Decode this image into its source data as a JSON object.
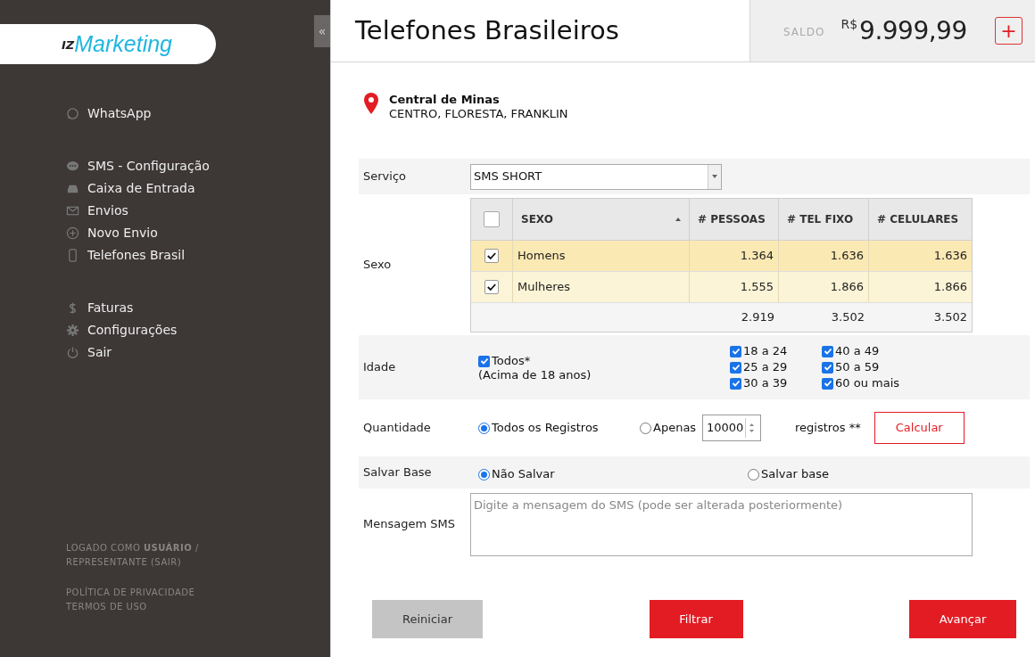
{
  "sidebar": {
    "logo": {
      "prefix": "IZ",
      "name": "Marketing"
    },
    "collapse_button": "«",
    "nav_groups": [
      [
        {
          "label": "WhatsApp",
          "kind": "whatsapp"
        }
      ],
      [
        {
          "label": "SMS - Configuração",
          "kind": "chat"
        },
        {
          "label": "Caixa de Entrada",
          "kind": "inbox"
        },
        {
          "label": "Envios",
          "kind": "mail"
        },
        {
          "label": "Novo Envio",
          "kind": "plus"
        },
        {
          "label": "Telefones Brasil",
          "kind": "phone"
        }
      ],
      [
        {
          "label": "Faturas",
          "kind": "dollar"
        },
        {
          "label": "Configurações",
          "kind": "gear"
        },
        {
          "label": "Sair",
          "kind": "power"
        }
      ]
    ],
    "login_lines": [
      "LOGADO COMO **USUÁRIO** /",
      "REPRESENTANTE (SAIR)"
    ],
    "footer_links": [
      "POLÍTICA DE PRIVACIDADE",
      "TERMOS DE USO"
    ]
  },
  "header": {
    "title": "Telefones Brasileiros",
    "balance_label": "SALDO",
    "currency": "R$",
    "balance": "9.999,99",
    "add_button": "+"
  },
  "location": {
    "name": "Central de Minas",
    "areas": "CENTRO, FLORESTA, FRANKLIN"
  },
  "form": {
    "servico": {
      "label": "Serviço",
      "value": "SMS SHORT"
    },
    "sexo": {
      "label": "Sexo",
      "all_checked": false,
      "columns": [
        {
          "label": "SEXO",
          "sorted": true
        },
        {
          "label": "# PESSOAS",
          "sorted": false
        },
        {
          "label": "# TEL FIXO",
          "sorted": false
        },
        {
          "label": "# CELULARES",
          "sorted": false
        }
      ],
      "rows": [
        {
          "checked": true,
          "selected": true,
          "cells": [
            "Homens",
            "1.364",
            "1.636",
            "1.636"
          ]
        },
        {
          "checked": true,
          "selected": false,
          "cells": [
            "Mulheres",
            "1.555",
            "1.866",
            "1.866"
          ]
        }
      ],
      "totals": [
        "2.919",
        "3.502",
        "3.502"
      ]
    },
    "idade": {
      "label": "Idade",
      "all": {
        "label": "Todos*",
        "checked": true
      },
      "all_note": "(Acima de 18 anos)",
      "ranges": [
        {
          "label": "18 a 24",
          "checked": true
        },
        {
          "label": "40 a 49",
          "checked": true
        },
        {
          "label": "25 a 29",
          "checked": true
        },
        {
          "label": "50 a 59",
          "checked": true
        },
        {
          "label": "30 a 39",
          "checked": true
        },
        {
          "label": "60 ou mais",
          "checked": true
        }
      ]
    },
    "quantidade": {
      "label": "Quantidade",
      "options": [
        {
          "label": "Todos os Registros",
          "selected": true
        },
        {
          "label": "Apenas",
          "selected": false
        }
      ],
      "amount": "10000",
      "unit": "registros **",
      "calc_button": "Calcular"
    },
    "salvar": {
      "label": "Salvar Base",
      "options": [
        {
          "label": "Não Salvar",
          "selected": true
        },
        {
          "label": "Salvar base",
          "selected": false
        }
      ]
    },
    "mensagem": {
      "label": "Mensagem SMS",
      "placeholder": "Digite a mensagem do SMS (pode ser alterada posteriormente)"
    }
  },
  "actions": [
    {
      "label": "Reiniciar",
      "kind": "secondary"
    },
    {
      "label": "Filtrar",
      "kind": "primary"
    },
    {
      "label": "Avançar",
      "kind": "primary"
    }
  ]
}
